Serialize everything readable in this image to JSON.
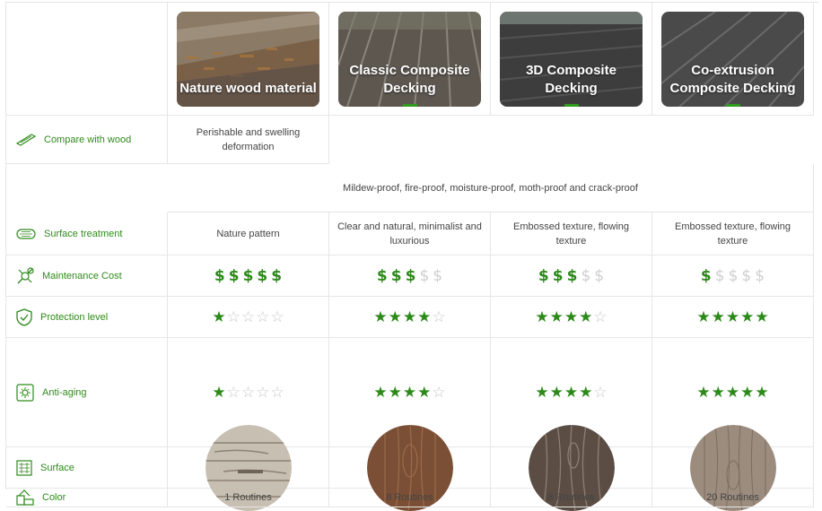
{
  "columns": [
    {
      "title": "Nature wood material"
    },
    {
      "title": "Classic Composite Decking"
    },
    {
      "title": "3D Composite Decking"
    },
    {
      "title": "Co-extrusion Composite Decking"
    }
  ],
  "rows": {
    "compare": {
      "label": "Compare with wood",
      "icon": "plank-icon",
      "nature": "Perishable and swelling deformation",
      "composite": "Mildew-proof, fire-proof, moisture-proof, moth-proof and crack-proof"
    },
    "surface_treatment": {
      "label": "Surface treatment",
      "icon": "texture-icon",
      "values": [
        "Nature pattern",
        "Clear and natural, minimalist and luxurious",
        "Embossed texture, flowing texture",
        "Embossed texture, flowing texture"
      ]
    },
    "maintenance": {
      "label": "Maintenance Cost",
      "icon": "tools-icon",
      "symbol": "$",
      "max": 5,
      "levels": [
        5,
        3,
        3,
        1
      ]
    },
    "protection": {
      "label": "Protection level",
      "icon": "shield-icon",
      "max": 5,
      "levels": [
        1,
        4,
        4,
        5
      ]
    },
    "anti_aging": {
      "label": "Anti-aging",
      "icon": "sun-icon",
      "max": 5,
      "levels": [
        1,
        4,
        4,
        5
      ]
    },
    "surface": {
      "label": "Surface",
      "icon": "grain-icon"
    },
    "color": {
      "label": "Color",
      "icon": "swatch-icon",
      "values": [
        "1 Routines",
        "8 Routines",
        "8 Routines",
        "20 Routines"
      ]
    }
  },
  "colors": {
    "accent": "#2d8a1a",
    "muted": "#cfcfcf"
  }
}
